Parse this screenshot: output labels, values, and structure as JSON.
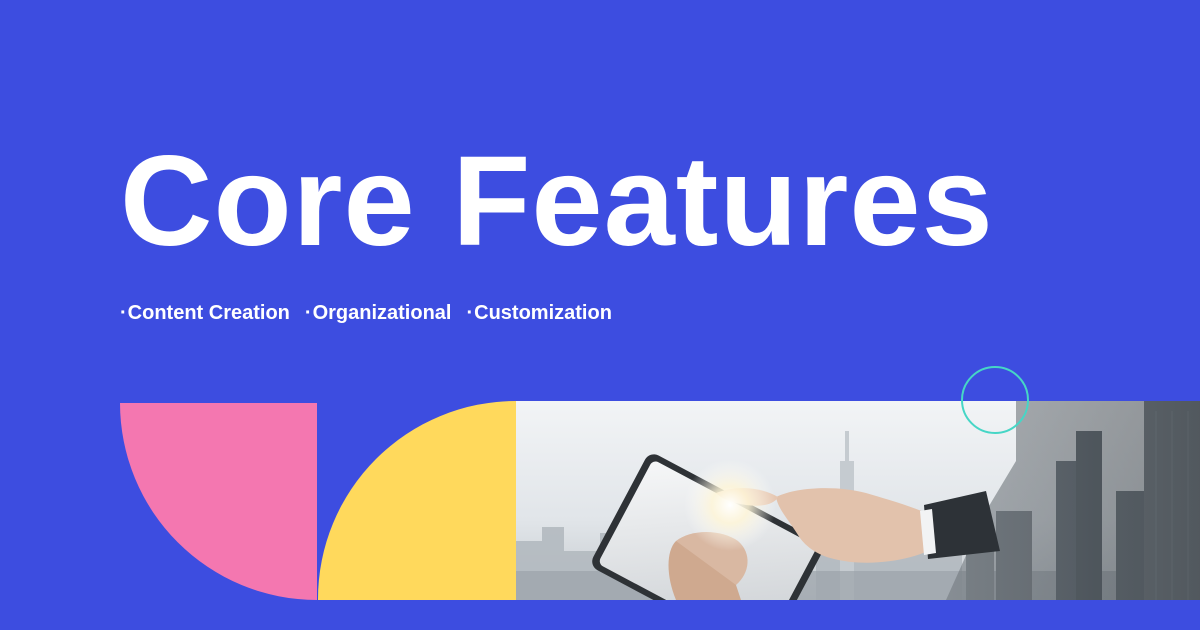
{
  "hero": {
    "title": "Core Features"
  },
  "features": [
    {
      "bullet": "·",
      "label": "Content Creation"
    },
    {
      "bullet": "·",
      "label": "Organizational"
    },
    {
      "bullet": "·",
      "label": "Customization"
    }
  ],
  "colors": {
    "background": "#3d4de0",
    "text": "#ffffff",
    "pink_shape": "#f477b0",
    "yellow_shape": "#ffd95c",
    "teal_ring": "#46d6c6"
  },
  "images": {
    "photo": "business-person-touching-tablet-over-city-skyline"
  }
}
